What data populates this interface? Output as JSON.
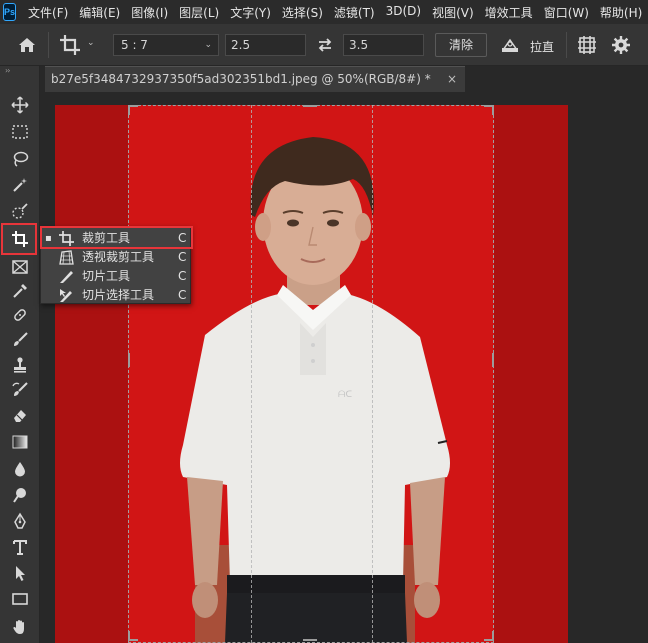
{
  "app": {
    "logo": "Ps"
  },
  "menu": [
    "文件(F)",
    "编辑(E)",
    "图像(I)",
    "图层(L)",
    "文字(Y)",
    "选择(S)",
    "滤镜(T)",
    "3D(D)",
    "视图(V)",
    "增效工具",
    "窗口(W)",
    "帮助(H)"
  ],
  "options": {
    "ratio": "5 : 7",
    "width_value": "2.5",
    "height_value": "3.5",
    "clear_label": "清除",
    "straighten_label": "拉直"
  },
  "tools_panel": {
    "collapse": "››"
  },
  "document": {
    "tab_title": "b27e5f3484732937350f5ad302351bd1.jpeg @ 50%(RGB/8#) *",
    "close": "×"
  },
  "flyout": {
    "items": [
      {
        "label": "裁剪工具",
        "shortcut": "C",
        "selected": true,
        "bullet": "▪"
      },
      {
        "label": "透视裁剪工具",
        "shortcut": "C",
        "selected": false,
        "bullet": ""
      },
      {
        "label": "切片工具",
        "shortcut": "C",
        "selected": false,
        "bullet": ""
      },
      {
        "label": "切片选择工具",
        "shortcut": "C",
        "selected": false,
        "bullet": ""
      }
    ]
  },
  "colors": {
    "highlight": "#e8353a",
    "canvas_red": "#d11515",
    "panel": "#353535"
  }
}
